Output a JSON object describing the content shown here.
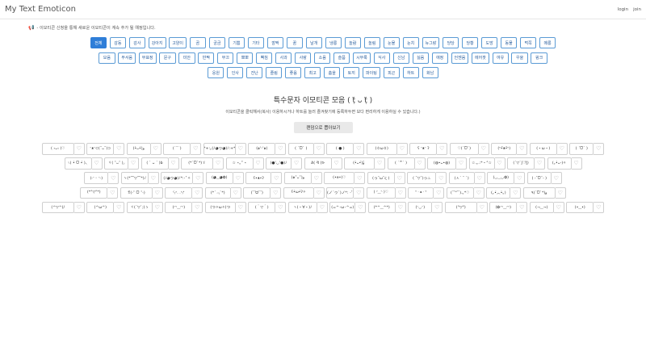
{
  "header": {
    "brand": "My Text Emoticon",
    "login": "login",
    "join": "join"
  },
  "notice": "- 이모티콘 신청을 통해 새로운 이모티콘이 계속 추가 될 예정입니다.",
  "categories": [
    [
      "전체",
      "감동",
      "감사",
      "강아지",
      "고양이",
      "곰",
      "궁금",
      "기쁨",
      "기타",
      "깜짝",
      "꿈",
      "날개",
      "냉롱",
      "놀람",
      "놀림",
      "눈물",
      "눈치",
      "뉴그랑",
      "당당",
      "당황",
      "도망",
      "동물",
      "먹쪽",
      "메롱"
    ],
    [
      "모음",
      "무서움",
      "무표정",
      "문구",
      "미안",
      "반짝",
      "부끄",
      "뽀뽀",
      "빡침",
      "사과",
      "사랑",
      "소음",
      "슬픔",
      "시무룩",
      "식사",
      "신남",
      "싫음",
      "애정",
      "언젠음",
      "에어팟",
      "여유",
      "우울",
      "윙크"
    ],
    [
      "응원",
      "인사",
      "잔난",
      "졸림",
      "좋음",
      "최고",
      "춤을",
      "토끼",
      "파이팅",
      "피곤",
      "하트",
      "화남"
    ]
  ],
  "active_category": "전체",
  "title": "특수문자 이모티콘 모음 ( ṭ̈ ᴗ ṭ̈ )",
  "subtitle": "이모티콘을 클릭해서(복사) 이용하시거나 하트를 눌러 즐겨찾기에 등록하두면 보다 편리하게 이용하실 수 있습니다.)",
  "random_button": "랜덤으로 뽑아보기",
  "heart_icon": "♡",
  "emoticons": [
    [
      "( ›ᴗ‹ )♡",
      "ᵔᴥᵔ⊂(˘ᴗ˘)⊃",
      "(•̀ᴗ•́)و",
      "(˙˘˙)",
      "*+:｡(ﾉ◕ヮ◕)ﾉ:+*",
      "(๑'ᵕ'๑)",
      "( ´ᗜ` )",
      "( ● )",
      "(ㆁωㆁ)",
      "ʕ ᵔᴥᵔ ʔ",
      "♡(ˊᗜˋ)",
      "(ᐡ•̆ᴥ•̆ᐡ)",
      "(・ω・)",
      "( ´ᗜ` )"
    ],
    [
      "৻( •̀ ᗜ •́ )৲",
      "ヾ( ˃ᴗ˂ )◞",
      "( ` ᴗ ´ )b",
      "(*´ᗜ`*)ゞ",
      "☆ ⋆｡˚ ⋆",
      "(●'◡'●)ﾉ",
      "ᕕ( ᐛ )ᕗ",
      "(•̀ᴗ•́)و ̑̑",
      "( ˙꒳˙ )",
      "(◍•ᴗ•◍)",
      "☆.｡.:*・°☆",
      "(´▽`ʃ♡ƪ)",
      "(｡•̀ᴗ-)✧"
    ],
    [
      "(˶ᵔ ᵕ ᵔ˶)",
      "ヽ(*⌒▽⌒*)ﾉ",
      "(ﾉ◕ヮ◕)ﾉ*:･ﾟ✧",
      "(◕‿◕✿)",
      "ʕ•ᴥ•ʔ",
      "(๑˃ᴗ˂)ﻭ",
      "(•ө•)♡",
      "(っ˘ω˘ς )",
      "( ˘▽˘)っ♨",
      "(ㅅ´ ˘ `)",
      "(◡‿◡✿)",
      "( ˶ˆᗜˆ˵ )"
    ],
    [
      "(*°▽°*)",
      "ꉂ(˵˃ ᗜ ˂˵)",
      "ᑦ₍ᐢ. .ᐢ₎ᑋ",
      "(*´﹃`*)",
      "(⁀ᗢ⁀)",
      "ʕ•̀ω•́ʔ✧",
      "(ノ´ヮ`)ノ*: ･ﾟ",
      "( ◜‿◝ )♡",
      "ᐡ ᐧ ﻌ ᐧ ᐡ",
      "(˘︶˘).｡*♡",
      "(｡•́︿•̀｡)",
      "٩(ˊᗜˋ*)و"
    ],
    [
      "(^▽^)/",
      "(^ω^)",
      "ヾ(´▽`;)ゝ",
      "(◠‿◠)",
      "(つ✧ω✧)つ",
      "(＾▽＾)",
      "ヽ(・∀・)ﾉ",
      "(=^･ω･^=)",
      "(*^‿^*)",
      "(ᵔ◡ᵔ)",
      "(°▽°)",
      "(✿◠‿◠)",
      "(¬‿¬)",
      "(•‿•)"
    ]
  ]
}
